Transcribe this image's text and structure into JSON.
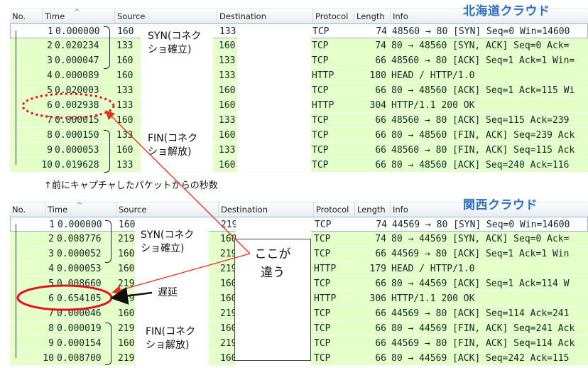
{
  "columns": [
    "No.",
    "Time",
    "Source",
    "Destination",
    "Protocol",
    "Length",
    "Info"
  ],
  "sort_indicator": "^",
  "panel_top": {
    "cloud_label": "北海道クラウド",
    "rows": [
      {
        "no": "1",
        "time": "0.000000",
        "src": "160",
        "dst": "133",
        "proto": "TCP",
        "len": "74",
        "info": "48560 → 80 [SYN] Seq=0 Win=14600"
      },
      {
        "no": "2",
        "time": "0.020234",
        "src": "133",
        "dst": "160",
        "proto": "TCP",
        "len": "74",
        "info": "80 → 48560 [SYN, ACK] Seq=0 Ack="
      },
      {
        "no": "3",
        "time": "0.000047",
        "src": "160",
        "dst": "133",
        "proto": "TCP",
        "len": "66",
        "info": "48560 → 80 [ACK] Seq=1 Ack=1 Win="
      },
      {
        "no": "4",
        "time": "0.000089",
        "src": "160",
        "dst": "133",
        "proto": "HTTP",
        "len": "180",
        "info": "HEAD / HTTP/1.0"
      },
      {
        "no": "5",
        "time": "0.020003",
        "src": "133",
        "dst": "160",
        "proto": "TCP",
        "len": "66",
        "info": "80 → 48560 [ACK] Seq=1 Ack=115 Wi"
      },
      {
        "no": "6",
        "time": "0.002938",
        "src": "133",
        "dst": "160",
        "proto": "HTTP",
        "len": "304",
        "info": "HTTP/1.1 200 OK"
      },
      {
        "no": "7",
        "time": "0.000015",
        "src": "160",
        "dst": "133",
        "proto": "TCP",
        "len": "66",
        "info": "48560 → 80 [ACK] Seq=115 Ack=239"
      },
      {
        "no": "8",
        "time": "0.000150",
        "src": "133",
        "dst": "160",
        "proto": "TCP",
        "len": "66",
        "info": "80 → 48560 [FIN, ACK] Seq=239 Ack"
      },
      {
        "no": "9",
        "time": "0.000053",
        "src": "160",
        "dst": "133",
        "proto": "TCP",
        "len": "66",
        "info": "48560 → 80 [FIN, ACK] Seq=115 Ack"
      },
      {
        "no": "10",
        "time": "0.019628",
        "src": "133",
        "dst": "160",
        "proto": "TCP",
        "len": "66",
        "info": "80 → 48560 [ACK] Seq=240 Ack=116"
      }
    ],
    "syn_label": "SYN(コネク\nショ確立)",
    "fin_label": "FIN(コネク\nショ解放)"
  },
  "time_note": "↑前にキャプチャしたパケットからの秒数",
  "panel_bottom": {
    "cloud_label": "関西クラウド",
    "rows": [
      {
        "no": "1",
        "time": "0.000000",
        "src": "160",
        "dst": "219",
        "proto": "TCP",
        "len": "74",
        "info": "44569 → 80 [SYN] Seq=0 Win=14600"
      },
      {
        "no": "2",
        "time": "0.008776",
        "src": "219",
        "dst": "160",
        "proto": "TCP",
        "len": "74",
        "info": "80 → 44569 [SYN, ACK] Seq=0 Ack="
      },
      {
        "no": "3",
        "time": "0.000052",
        "src": "160",
        "dst": "219",
        "proto": "TCP",
        "len": "66",
        "info": "44569 → 80 [ACK] Seq=1 Ack=1 Win"
      },
      {
        "no": "4",
        "time": "0.000053",
        "src": "160",
        "dst": "219",
        "proto": "HTTP",
        "len": "179",
        "info": "HEAD / HTTP/1.0"
      },
      {
        "no": "5",
        "time": "0.008660",
        "src": "219",
        "dst": "160",
        "proto": "TCP",
        "len": "66",
        "info": "80 → 44569 [ACK] Seq=1 Ack=114 W"
      },
      {
        "no": "6",
        "time": "0.654105",
        "src": "219",
        "dst": "160",
        "proto": "HTTP",
        "len": "306",
        "info": "HTTP/1.1 200 OK"
      },
      {
        "no": "7",
        "time": "0.000046",
        "src": "160",
        "dst": "219",
        "proto": "TCP",
        "len": "66",
        "info": "44569 → 80 [ACK] Seq=114 Ack=241"
      },
      {
        "no": "8",
        "time": "0.000019",
        "src": "219",
        "dst": "160",
        "proto": "TCP",
        "len": "66",
        "info": "80 → 44569 [FIN, ACK] Seq=241 Ack"
      },
      {
        "no": "9",
        "time": "0.000154",
        "src": "160",
        "dst": "219",
        "proto": "TCP",
        "len": "66",
        "info": "44569 → 80 [FIN, ACK] Seq=114 Ack"
      },
      {
        "no": "10",
        "time": "0.008700",
        "src": "219",
        "dst": "160",
        "proto": "TCP",
        "len": "66",
        "info": "80 → 44569 [ACK] Seq=242 Ack=115"
      }
    ],
    "syn_label": "SYN(コネク\nショ確立)",
    "fin_label": "FIN(コネク\nショ解放)",
    "delay_label": "遅延"
  },
  "difference_label": "ここが\n違う",
  "colors": {
    "row_bg": "#e4ffc7",
    "cloud_label": "#2e6fc4",
    "highlight_red": "#e0121a",
    "arrow": "#e2311e"
  }
}
